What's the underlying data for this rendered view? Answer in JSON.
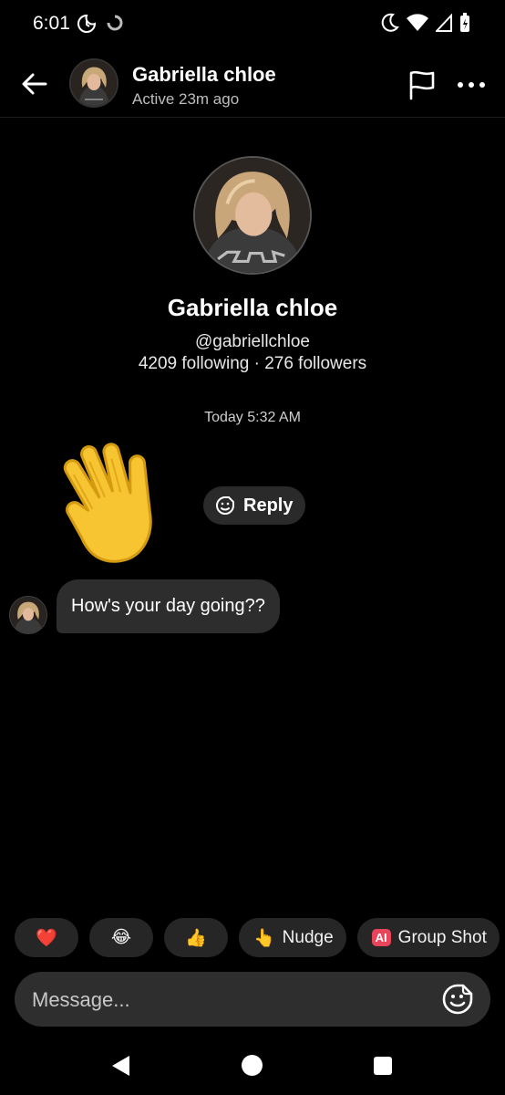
{
  "status_bar": {
    "time": "6:01",
    "left_icons": [
      "moon-clock-icon",
      "loading-icon"
    ],
    "right_icons": [
      "dnd-moon-icon",
      "wifi-icon",
      "signal-icon",
      "battery-icon"
    ]
  },
  "header": {
    "name": "Gabriella chloe",
    "status": "Active 23m ago",
    "icons": [
      "back-arrow-icon",
      "flag-icon",
      "more-icon"
    ]
  },
  "profile": {
    "name": "Gabriella chloe",
    "handle": "@gabriellchloe",
    "stats": "4209 following · 276 followers"
  },
  "conversation": {
    "timestamp": "Today 5:32 AM",
    "sticker": "waving-hand",
    "reply_label": "Reply",
    "message": "How's your day going??"
  },
  "quick_reactions": {
    "heart": "❤️",
    "laugh": "😂",
    "thumbs": "👍",
    "nudge_emoji": "👆",
    "nudge_label": "Nudge",
    "group_shot_badge": "AI",
    "group_shot_label": "Group Shot"
  },
  "composer": {
    "placeholder": "Message..."
  },
  "colors": {
    "background": "#000000",
    "bubble": "#2d2d2d",
    "chip": "#262626",
    "ai_badge": "#e8455a"
  }
}
